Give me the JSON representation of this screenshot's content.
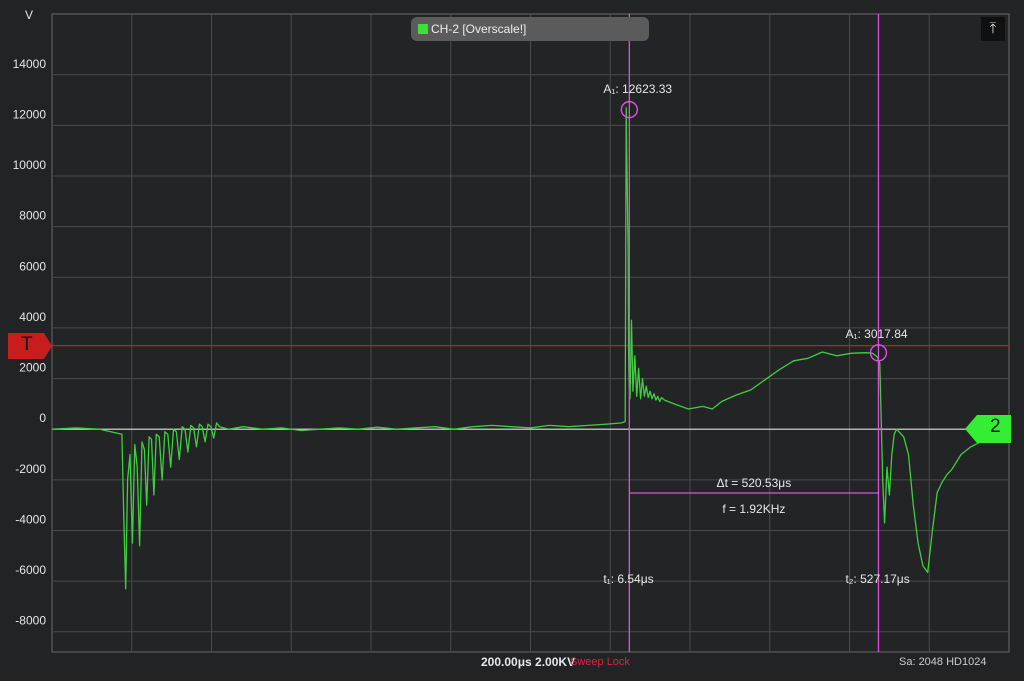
{
  "unit_label": "V",
  "channel_badge": {
    "label": "CH-2 [Overscale!]",
    "color": "#38e23a"
  },
  "autoscale_icon": "autoscale-icon",
  "trigger_marker": {
    "label": "T",
    "color": "#c81d1d",
    "level": 3300
  },
  "channel_marker": {
    "label": "2",
    "color": "#33ee33"
  },
  "cursors": {
    "a1": {
      "label": "A₁: 12623.33",
      "value": 12623.33
    },
    "a2": {
      "label": "A₁: 3017.84",
      "value": 3017.84
    },
    "t1": {
      "label": "t₁: 6.54μs",
      "value": 6.54
    },
    "t2": {
      "label": "t₂: 527.17μs",
      "value": 527.17
    },
    "delta_t": "Δt = 520.53μs",
    "freq": "f = 1.92KHz",
    "color": "#e050e0"
  },
  "status": {
    "timebase": "200.00μs  2.00KV",
    "sweep": "Sweep Lock",
    "samples": "Sa: 2048  HD1024"
  },
  "chart_data": {
    "type": "line",
    "xlabel": "",
    "ylabel": "V",
    "x_units": "μs",
    "xlim": [
      -1200,
      800
    ],
    "ylim": [
      -8800,
      16400
    ],
    "yticks": [
      -8000,
      -6000,
      -4000,
      -2000,
      0,
      2000,
      4000,
      6000,
      8000,
      10000,
      12000,
      14000
    ],
    "ytick_labels": [
      "-8000",
      "-6000",
      "-4000",
      "-2000",
      "0",
      "2000",
      "4000",
      "6000",
      "8000",
      "10000",
      "12000",
      "14000"
    ],
    "grid": true,
    "series": [
      {
        "color": "#3ecf3e",
        "x": [
          -1200,
          -1150,
          -1100,
          -1054,
          -1050,
          -1046,
          -1042,
          -1037,
          -1032,
          -1027,
          -1022,
          -1017,
          -1012,
          -1007,
          -1002,
          -997,
          -992,
          -987,
          -982,
          -976,
          -970,
          -964,
          -958,
          -952,
          -946,
          -940,
          -934,
          -928,
          -922,
          -916,
          -910,
          -904,
          -898,
          -892,
          -886,
          -880,
          -874,
          -868,
          -862,
          -856,
          -850,
          -830,
          -800,
          -760,
          -720,
          -680,
          -640,
          -600,
          -560,
          -520,
          -480,
          -440,
          -400,
          -360,
          -320,
          -280,
          -240,
          -200,
          -160,
          -120,
          -80,
          -40,
          -10,
          -2,
          0,
          2,
          4,
          5,
          6,
          8,
          11,
          14,
          18,
          22,
          26,
          30,
          34,
          38,
          42,
          46,
          50,
          54,
          58,
          62,
          66,
          70,
          74,
          80,
          100,
          130,
          160,
          180,
          200,
          230,
          260,
          290,
          320,
          350,
          380,
          410,
          440,
          470,
          500,
          515,
          525,
          530,
          536,
          540,
          545,
          550,
          555,
          560,
          565,
          570,
          580,
          590,
          600,
          610,
          620,
          630,
          640,
          650,
          660,
          670,
          680,
          690,
          700,
          720,
          740,
          760,
          780,
          800
        ],
        "y": [
          0,
          50,
          0,
          -200,
          -3500,
          -6300,
          -2000,
          -1000,
          -4500,
          -600,
          -1500,
          -4600,
          -500,
          -800,
          -3000,
          -300,
          -400,
          -2600,
          -200,
          -300,
          -2000,
          -100,
          -200,
          -1500,
          0,
          -100,
          -1200,
          100,
          0,
          -900,
          150,
          50,
          -700,
          200,
          100,
          -500,
          200,
          100,
          -350,
          250,
          100,
          0,
          100,
          0,
          50,
          -50,
          0,
          50,
          0,
          80,
          0,
          50,
          100,
          0,
          100,
          150,
          100,
          50,
          150,
          100,
          150,
          200,
          250,
          300,
          12700,
          9700,
          7200,
          3000,
          1800,
          1200,
          4300,
          1500,
          2900,
          1300,
          2400,
          1200,
          2000,
          1300,
          1700,
          1250,
          1500,
          1200,
          1400,
          1150,
          1300,
          1100,
          1250,
          1150,
          1000,
          800,
          900,
          800,
          1100,
          1350,
          1550,
          1950,
          2350,
          2700,
          2800,
          3050,
          2900,
          3000,
          3020,
          3000,
          2850,
          2600,
          -2000,
          -3700,
          -1500,
          -2600,
          -1000,
          -200,
          0,
          -100,
          -300,
          -1000,
          -3000,
          -4500,
          -5400,
          -5650,
          -4000,
          -2500,
          -2100,
          -1800,
          -1600,
          -1300,
          -1000,
          -700,
          -500,
          -300,
          -150,
          100
        ]
      }
    ]
  }
}
